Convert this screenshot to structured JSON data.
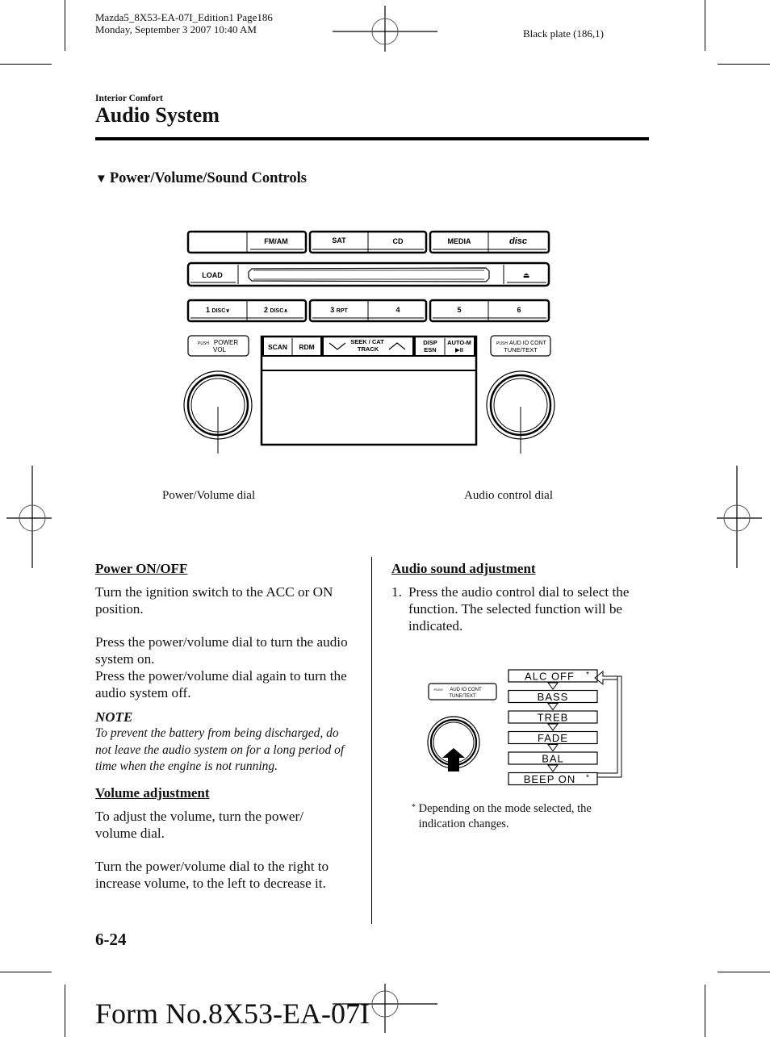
{
  "print_header": {
    "line1": "Mazda5_8X53-EA-07I_Edition1 Page186",
    "line2": "Monday, September 3 2007 10:40 AM",
    "plate": "Black plate (186,1)"
  },
  "breadcrumb": "Interior Comfort",
  "page_title": "Audio System",
  "section": {
    "marker_icon": "down-triangle-icon",
    "marker_glyph": "▼",
    "title": "Power/Volume/Sound Controls"
  },
  "audio_unit": {
    "row1": [
      "",
      "FM/AM",
      "SAT",
      "CD",
      "MEDIA"
    ],
    "cd_logo": "disc",
    "row2": {
      "load": "LOAD",
      "eject_glyph": "⏏"
    },
    "row3": [
      {
        "num": "1",
        "sub": "DISC∨"
      },
      {
        "num": "2",
        "sub": "DISC∧"
      },
      {
        "num": "3",
        "sub": "RPT"
      },
      {
        "num": "4",
        "sub": ""
      },
      {
        "num": "5",
        "sub": ""
      },
      {
        "num": "6",
        "sub": ""
      }
    ],
    "power_label": {
      "push": "PUSH",
      "top": "POWER",
      "bottom": "VOL"
    },
    "audio_label": {
      "push": "PUSH",
      "top": "AUD IO CONT",
      "bottom": "TUNE/TEXT"
    },
    "display_buttons": {
      "scan": "SCAN",
      "rdm": "RDM",
      "seek_top": "SEEK / CAT",
      "seek_bottom": "TRACK",
      "disp_top": "DISP",
      "disp_bottom": "ESN",
      "auto_top": "AUTO-M",
      "auto_bottom": "▶II"
    },
    "callouts": {
      "power_dial": "Power/Volume dial",
      "audio_dial": "Audio control dial"
    }
  },
  "left_column": {
    "power_heading": "Power ON/OFF",
    "power_p1": "Turn the ignition switch to the ACC or ON position.",
    "power_p2": "Press the power/volume dial to turn the audio system on.",
    "power_p3": "Press the power/volume dial again to turn the audio system off.",
    "note_heading": "NOTE",
    "note_text": "To prevent the battery from being discharged, do not leave the audio system on for a long period of time when the engine is not running.",
    "volume_heading": "Volume adjustment",
    "volume_p1": "To adjust the volume, turn the power/ volume dial.",
    "volume_p2": "Turn the power/volume dial to the right to increase volume, to the left to decrease it."
  },
  "right_column": {
    "heading": "Audio sound adjustment",
    "step_num": "1.",
    "step_text": "Press the audio control dial to select the function. The selected function will be indicated.",
    "cycle_items": [
      "ALC OFF",
      "BASS",
      "TREB",
      "FADE",
      "BAL",
      "BEEP ON"
    ],
    "asterisk": "*",
    "footnote": "Depending on the mode selected, the indication changes."
  },
  "footer": {
    "page_number": "6-24",
    "form_number": "Form No.8X53-EA-07I"
  }
}
